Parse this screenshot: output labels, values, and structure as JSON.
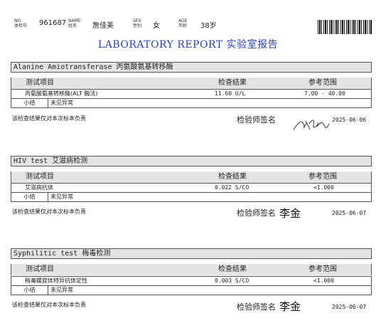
{
  "header": {
    "id_label": "NO\n体检号",
    "id_value": "961687",
    "name_label": "NAME\n姓名",
    "name_value": "詹佳美",
    "sex_label": "SEX\n性别",
    "sex_value": "女",
    "age_label": "AGE\n年龄",
    "age_value": "38岁"
  },
  "title": "LABORATORY REPORT 实验室报告",
  "columns": {
    "item": "测试项目",
    "result": "检查结果",
    "range": "参考范围"
  },
  "sections": [
    {
      "title": "Alanine Amiotransferase  丙氨酸氨基转移酶",
      "item": "丙氨酸氨基转移酶(ALT 酶法)",
      "result": "11.60  U/L",
      "range": "7.00 - 40.00",
      "summary_label": "小结",
      "summary_value": "未见异常",
      "note": "该检查结果仅对本次标本负责",
      "signer_label": "检验师签名",
      "signer_name": "",
      "date": "2025-06-06"
    },
    {
      "title": "HIV test  艾滋病检测",
      "item": "艾滋病抗体",
      "result": "0.022  S/CO",
      "range": "<1.000",
      "summary_label": "小结",
      "summary_value": "未见异常",
      "note": "该检查结果仅对本次标本负责",
      "signer_label": "检验师签名",
      "signer_name": "李金",
      "date": "2025-06-07"
    },
    {
      "title": "Syphilitic test  梅毒检测",
      "item": "梅毒螺旋体特异抗体定性",
      "result": "0.003  S/CO",
      "range": "<1.000",
      "summary_label": "小结",
      "summary_value": "未见异常",
      "note": "该检查结果仅对本次标本负责",
      "signer_label": "检验师签名",
      "signer_name": "李金",
      "date": "2025-06-07"
    }
  ]
}
